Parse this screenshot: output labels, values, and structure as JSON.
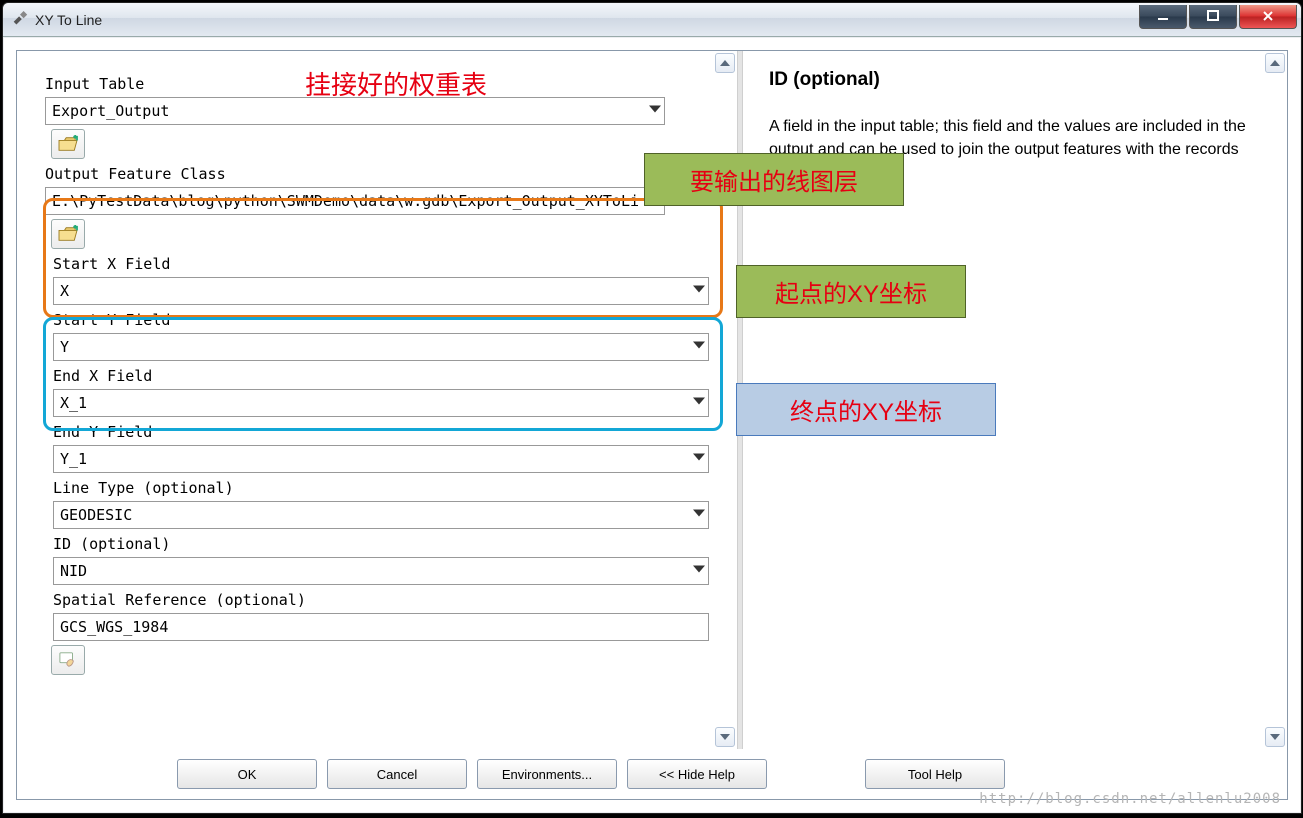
{
  "window": {
    "title": "XY To Line"
  },
  "form": {
    "input_table_label": "Input Table",
    "input_table_value": "Export_Output",
    "output_fc_label": "Output Feature Class",
    "output_fc_value": "E:\\PyTestData\\blog\\python\\SWMDemo\\data\\w.gdb\\Export_Output_XYToLine",
    "start_x_label": "Start X Field",
    "start_x_value": "X",
    "start_y_label": "Start Y Field",
    "start_y_value": "Y",
    "end_x_label": "End X Field",
    "end_x_value": "X_1",
    "end_y_label": "End Y Field",
    "end_y_value": "Y_1",
    "line_type_label": "Line Type (optional)",
    "line_type_value": "GEODESIC",
    "id_label": "ID (optional)",
    "id_value": "NID",
    "sr_label": "Spatial Reference (optional)",
    "sr_value": "GCS_WGS_1984"
  },
  "buttons": {
    "ok": "OK",
    "cancel": "Cancel",
    "env": "Environments...",
    "hide": "<< Hide Help",
    "toolhelp": "Tool Help"
  },
  "help": {
    "title": "ID (optional)",
    "body": "A field in the input table; this field and the values are included in the output and can be used to join the output features with the records in the input table."
  },
  "annotations": {
    "top_red": "挂接好的权重表",
    "output_badge": "要输出的线图层",
    "start_badge": "起点的XY坐标",
    "end_badge": "终点的XY坐标"
  },
  "watermark": "http://blog.csdn.net/allenlu2008"
}
